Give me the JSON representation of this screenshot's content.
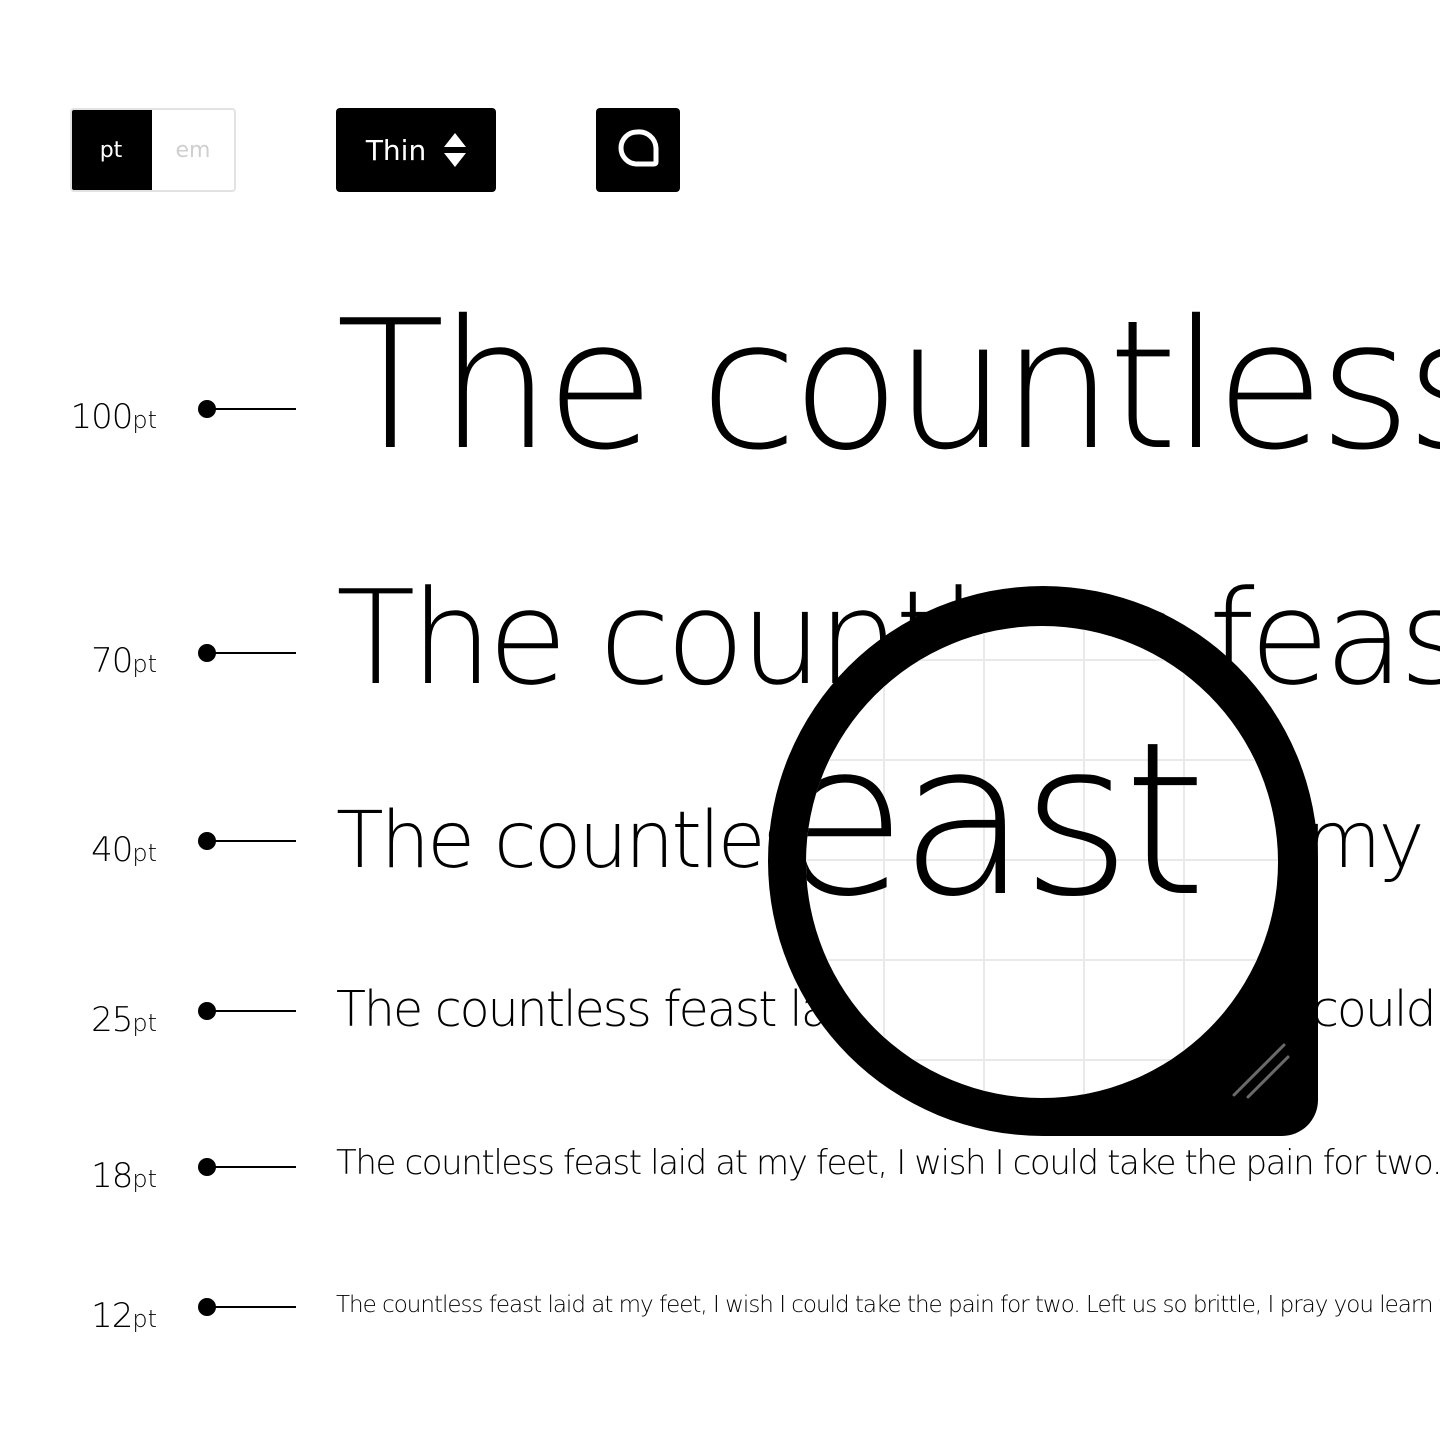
{
  "toolbar": {
    "unit_options": [
      "pt",
      "em"
    ],
    "unit_selected": "pt",
    "weight": "Thin",
    "lens_icon": "magnifier-icon"
  },
  "samples": [
    {
      "size": "100",
      "unit": "pt",
      "text": "The countless"
    },
    {
      "size": "70",
      "unit": "pt",
      "text": "The countless feast"
    },
    {
      "size": "40",
      "unit": "pt",
      "text": "The countless feast laid at my fee"
    },
    {
      "size": "25",
      "unit": "pt",
      "text": "The countless feast laid at my feet, I wish I could take"
    },
    {
      "size": "18",
      "unit": "pt",
      "text": "The countless feast laid at my feet, I wish I could take the pain for two. Left"
    },
    {
      "size": "12",
      "unit": "pt",
      "text": "The countless feast laid at my feet, I wish I could take the pain for two. Left us so brittle, I pray you learn to trust, h"
    }
  ],
  "loupe": {
    "text": "feast laid a"
  },
  "colors": {
    "foreground": "#000000",
    "background": "#ffffff",
    "inactive_text": "#cfcfcf",
    "grid": "#e9e9e9"
  }
}
